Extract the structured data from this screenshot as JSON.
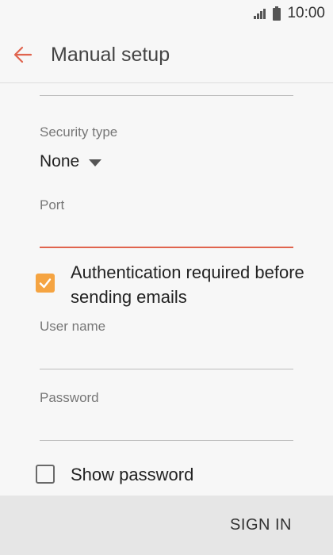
{
  "status_bar": {
    "time": "10:00",
    "icons": [
      "signal-icon",
      "battery-icon"
    ]
  },
  "app_bar": {
    "title": "Manual setup",
    "back_icon": "back-arrow-icon",
    "accent_color": "#e0644e"
  },
  "form": {
    "security_type": {
      "label": "Security type",
      "value": "None"
    },
    "port": {
      "label": "Port",
      "value": "",
      "focused": true
    },
    "authentication": {
      "label": "Authentication required before sending emails",
      "checked": true,
      "check_color": "#f5a442"
    },
    "user_name": {
      "label": "User name",
      "value": ""
    },
    "password": {
      "label": "Password",
      "value": ""
    },
    "show_password": {
      "label": "Show password",
      "checked": false
    }
  },
  "bottom_bar": {
    "sign_in_label": "SIGN IN"
  }
}
